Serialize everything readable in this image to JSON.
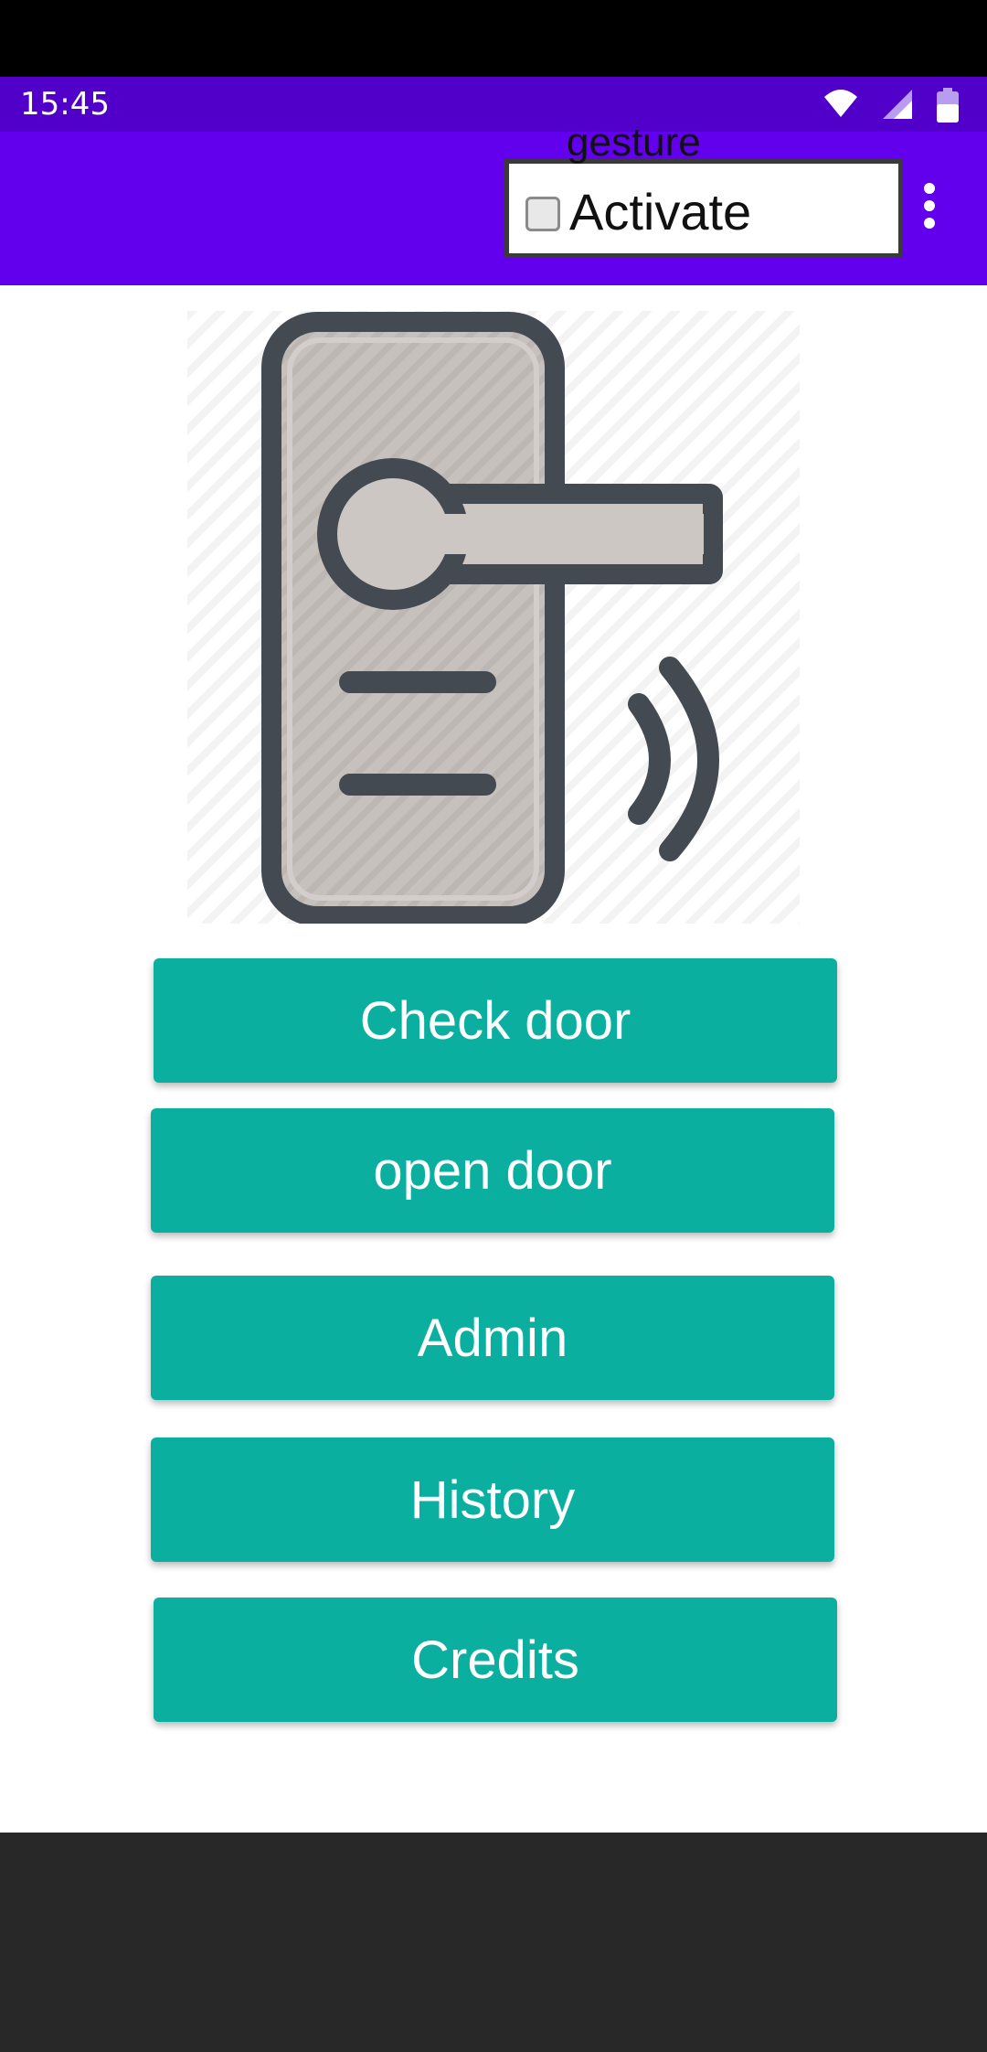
{
  "status_bar": {
    "time": "15:45",
    "icons": [
      "wifi-icon",
      "signal-icon",
      "battery-icon"
    ]
  },
  "app_bar": {
    "gesture_checkbox": {
      "checked": false,
      "label_line1": "Activate",
      "label_line2": "gesture"
    },
    "overflow_menu_icon": "more-vert-icon"
  },
  "hero_image": {
    "icon": "smart-door-lock-icon"
  },
  "buttons": {
    "check_door": "Check door",
    "open_door": "open door",
    "admin": "Admin",
    "history": "History",
    "credits": "Credits"
  },
  "colors": {
    "status_bar": "#5000c8",
    "app_bar": "#6200ee",
    "button": "#0aaf9f",
    "nav_bar": "#282828"
  }
}
